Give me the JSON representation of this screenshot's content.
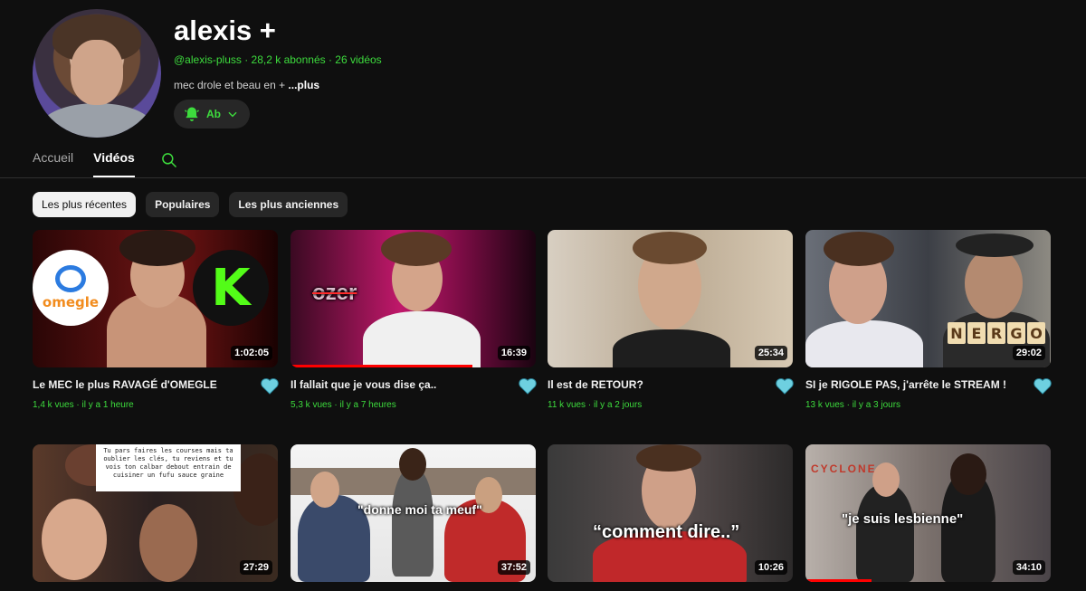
{
  "channel": {
    "name": "alexis +",
    "handle": "@alexis-pluss",
    "subscribers": "28,2 k abonnés",
    "video_count": "26 vidéos",
    "meta_separator": " · ",
    "description": "mec drole et beau en + ",
    "description_more": "...plus",
    "subscribe_label": "Ab"
  },
  "tabs": [
    {
      "label": "Accueil",
      "active": false
    },
    {
      "label": "Vidéos",
      "active": true
    }
  ],
  "filters": [
    {
      "label": "Les plus récentes",
      "active": true
    },
    {
      "label": "Populaires",
      "active": false
    },
    {
      "label": "Les plus anciennes",
      "active": false
    }
  ],
  "videos": [
    {
      "title": "Le MEC le plus RAVAGÉ d'OMEGLE",
      "views": "1,4 k vues",
      "age": "il y a 1 heure",
      "duration": "1:02:05",
      "watched_fraction": 0
    },
    {
      "title": "Il fallait que je vous dise ça..",
      "views": "5,3 k vues",
      "age": "il y a 7 heures",
      "duration": "16:39",
      "watched_fraction": 0.74
    },
    {
      "title": "Il est de RETOUR?",
      "views": "11 k vues",
      "age": "il y a 2 jours",
      "duration": "25:34",
      "watched_fraction": 0
    },
    {
      "title": "SI je RIGOLE PAS, j'arrête le STREAM !",
      "views": "13 k vues",
      "age": "il y a 3 jours",
      "duration": "29:02",
      "watched_fraction": 0
    },
    {
      "title": "",
      "views": "",
      "age": "",
      "duration": "27:29",
      "watched_fraction": 0
    },
    {
      "title": "",
      "views": "",
      "age": "",
      "duration": "37:52",
      "watched_fraction": 0
    },
    {
      "title": "",
      "views": "",
      "age": "",
      "duration": "10:26",
      "watched_fraction": 0
    },
    {
      "title": "",
      "views": "",
      "age": "",
      "duration": "34:10",
      "watched_fraction": 0.27
    }
  ],
  "thumb_text": {
    "omegle": "omegle",
    "kick": "K",
    "ozer": "ozer",
    "nergo": [
      "N",
      "E",
      "R",
      "G",
      "O"
    ],
    "bubble": "Tu pars faires les courses mais ta oublier les clés, tu reviens et tu vois ton calbar debout entrain de cuisiner un fufu sauce graine",
    "donne": "\"donne moi ta meuf\"",
    "comment": "“comment dire..”",
    "lesbienne": "\"je suis lesbienne\"",
    "cyclone": "CYCLONE"
  },
  "colors": {
    "accent": "#3ddc3d",
    "heart": "#6ed0e0",
    "background": "#0f0f0f",
    "progress": "#ff0000"
  },
  "icons": [
    "bell-icon",
    "chevron-down-icon",
    "search-icon",
    "heart-icon"
  ]
}
